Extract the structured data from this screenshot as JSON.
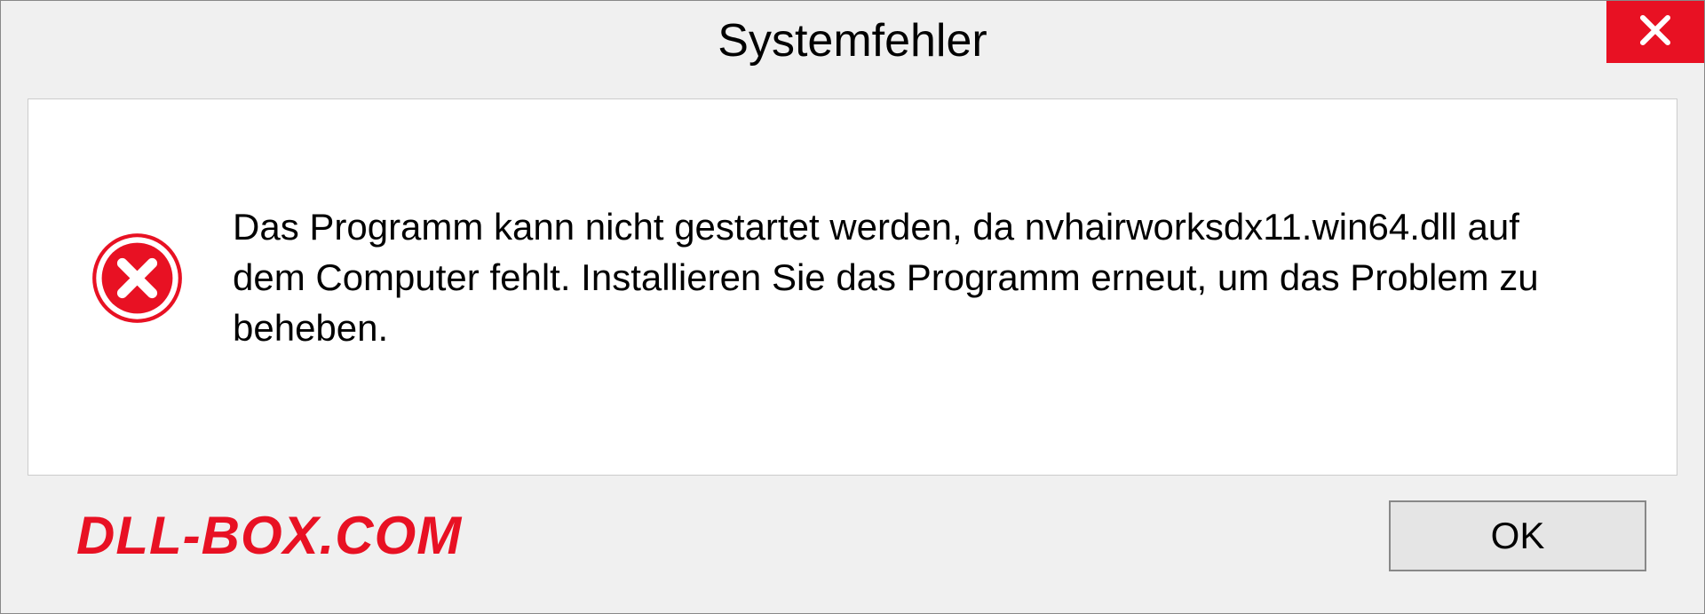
{
  "dialog": {
    "title": "Systemfehler",
    "message": "Das Programm kann nicht gestartet werden, da nvhairworksdx11.win64.dll auf dem Computer fehlt. Installieren Sie das Programm erneut, um das Problem zu beheben.",
    "ok_label": "OK"
  },
  "watermark": {
    "text": "DLL-BOX.COM"
  },
  "colors": {
    "error_red": "#e81123",
    "background": "#f0f0f0",
    "panel_white": "#ffffff"
  }
}
